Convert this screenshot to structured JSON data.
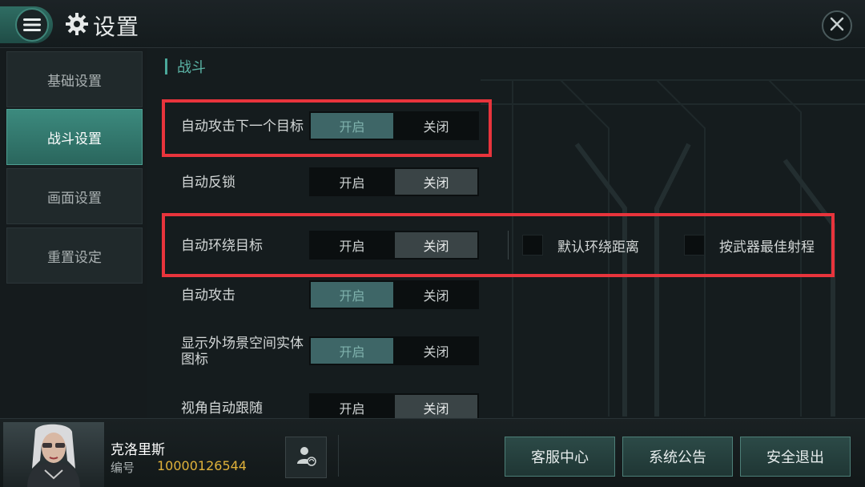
{
  "header": {
    "title": "设置"
  },
  "sidebar": {
    "items": [
      {
        "label": "基础设置"
      },
      {
        "label": "战斗设置"
      },
      {
        "label": "画面设置"
      },
      {
        "label": "重置设定"
      }
    ],
    "active_index": 1
  },
  "main": {
    "section_title": "战斗",
    "rows": [
      {
        "label": "自动攻击下一个目标",
        "on_label": "开启",
        "off_label": "关闭",
        "selected": "on"
      },
      {
        "label": "自动反锁",
        "on_label": "开启",
        "off_label": "关闭",
        "selected": "off"
      },
      {
        "label": "自动环绕目标",
        "on_label": "开启",
        "off_label": "关闭",
        "selected": "off",
        "options": [
          {
            "label": "默认环绕距离"
          },
          {
            "label": "按武器最佳射程"
          }
        ]
      },
      {
        "label": "自动攻击",
        "on_label": "开启",
        "off_label": "关闭",
        "selected": "on"
      },
      {
        "label_line1": "显示外场景空间实体",
        "label_line2": "图标",
        "on_label": "开启",
        "off_label": "关闭",
        "selected": "on"
      },
      {
        "label": "视角自动跟随",
        "on_label": "开启",
        "off_label": "关闭",
        "selected": "off"
      }
    ]
  },
  "footer": {
    "player_name": "克洛里斯",
    "id_label": "编号",
    "player_id": "10000126544",
    "buttons": [
      {
        "label": "客服中心"
      },
      {
        "label": "系统公告"
      },
      {
        "label": "安全退出"
      }
    ]
  },
  "colors": {
    "accent": "#3c8a7e",
    "highlight": "#e8343c",
    "id_gold": "#e0b23a"
  }
}
